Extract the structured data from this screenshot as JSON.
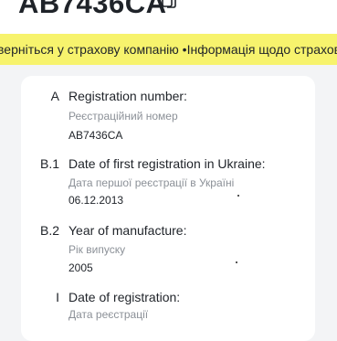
{
  "header": {
    "plate_number": "AB7436CA",
    "copy_icon": "copy-icon"
  },
  "banner": {
    "text": "верніться у страхову компанію  •Інформація щодо страхов",
    "background": "#f7f36d"
  },
  "fields": [
    {
      "code": "A",
      "label_en": "Registration number:",
      "label_ua": "Реєстраційний номер",
      "value": "AB7436CA"
    },
    {
      "code": "B.1",
      "label_en": "Date of first registration in Ukraine:",
      "label_ua": "Дата першої реєстрації в Україні",
      "value": "06.12.2013"
    },
    {
      "code": "B.2",
      "label_en": "Year of manufacture:",
      "label_ua": "Рік випуску",
      "value": "2005"
    },
    {
      "code": "I",
      "label_en": "Date of registration:",
      "label_ua": "Дата реєстрації",
      "value": ""
    }
  ]
}
